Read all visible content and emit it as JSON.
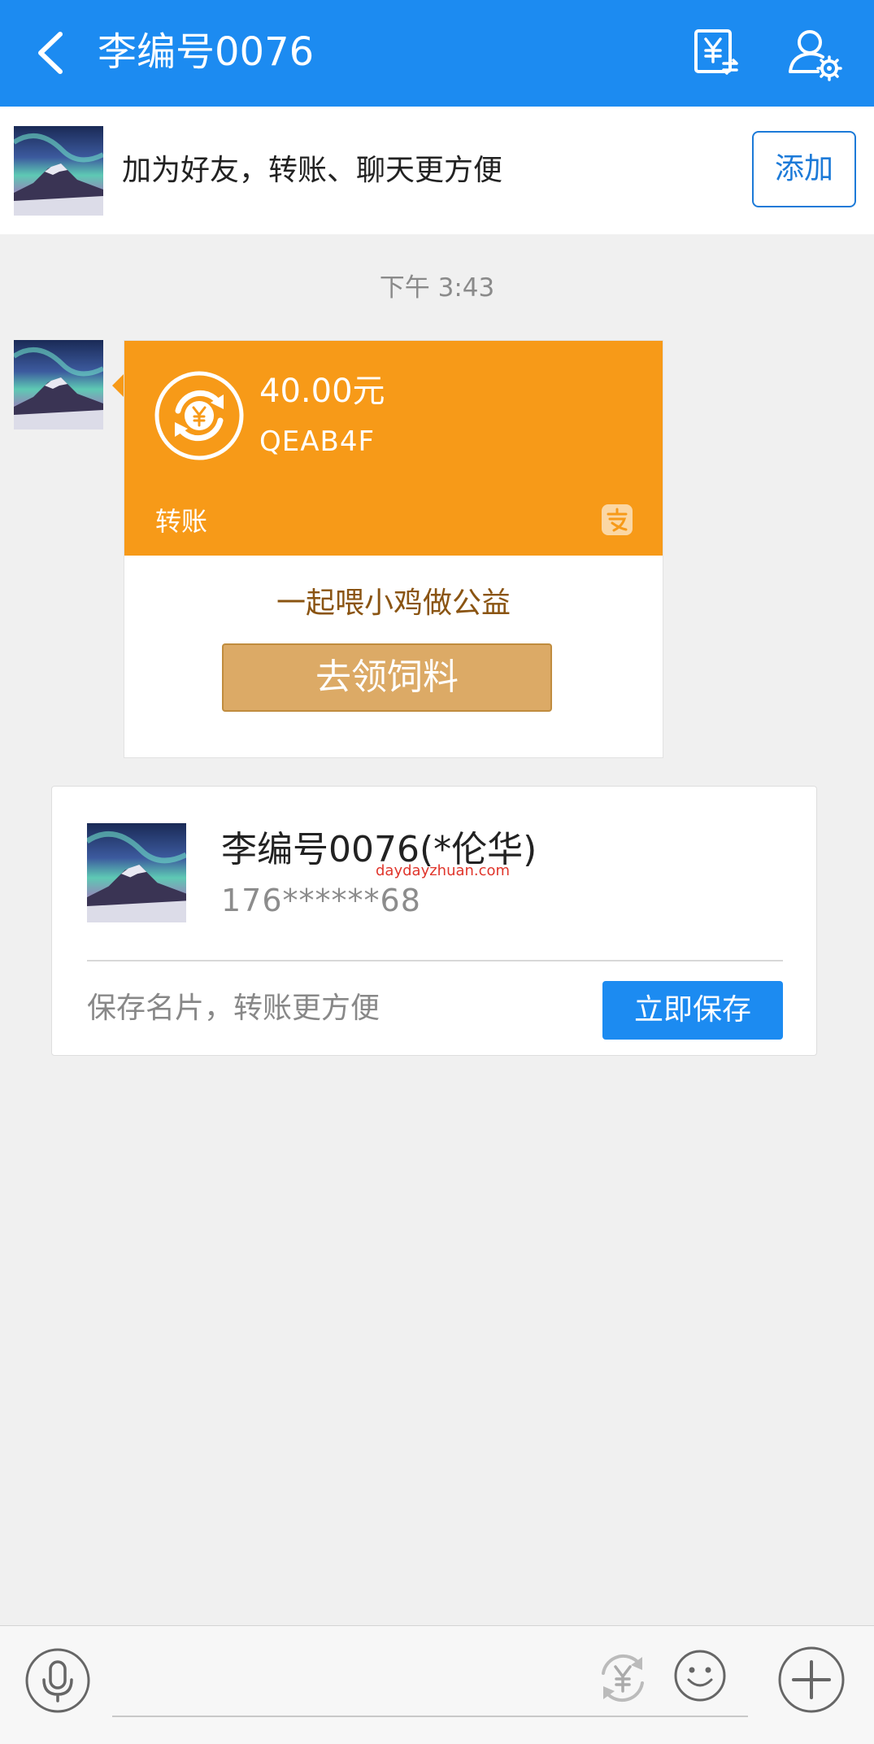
{
  "header": {
    "title": "李编号0076",
    "back_icon": "chevron-left-icon",
    "bill_icon": "bill-transfer-icon",
    "settings_icon": "user-settings-icon",
    "background_color": "#1c8bf1"
  },
  "friend_banner": {
    "text": "加为好友，转账、聊天更方便",
    "add_label": "添加"
  },
  "timestamp": "下午 3:43",
  "transfer_card": {
    "amount": "40.00元",
    "memo": "QEAB4F",
    "kind": "转账",
    "promo_text": "一起喂小鸡做公益",
    "promo_button": "去领饲料",
    "accent_color": "#f79a18"
  },
  "contact_card": {
    "name": "李编号0076(*伦华)",
    "watermark": "daydayzhuan.com",
    "phone": "176******68",
    "save_hint": "保存名片，转账更方便",
    "save_label": "立即保存"
  },
  "input_bar": {
    "placeholder": "",
    "voice_icon": "microphone-icon",
    "transfer_icon": "yuan-transfer-icon",
    "emoji_icon": "emoji-icon",
    "plus_icon": "plus-icon"
  }
}
